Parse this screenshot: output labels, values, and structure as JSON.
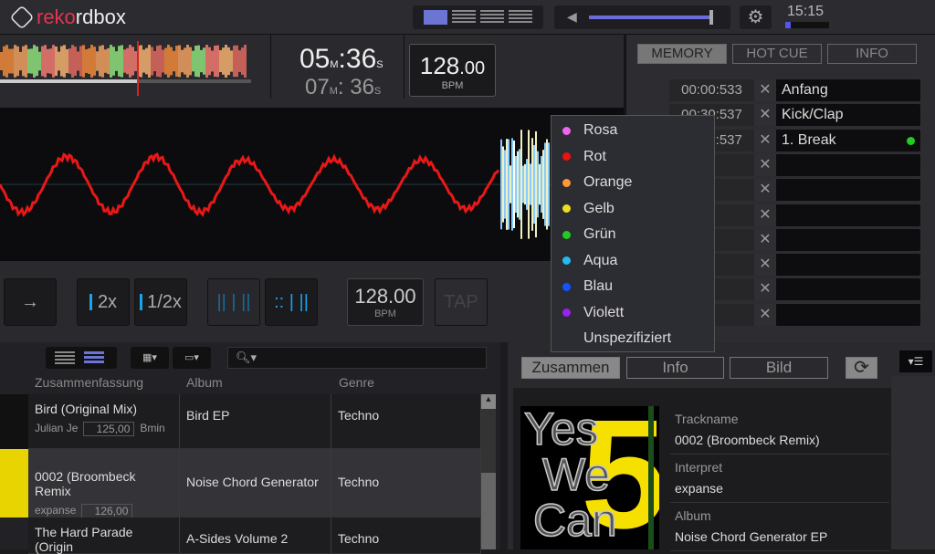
{
  "app": {
    "name_part1": "reko",
    "name_part2": "rdbox",
    "clock": "15:15"
  },
  "deck": {
    "time_elapsed_m": "05",
    "time_elapsed_s": "36",
    "time_remain_m": "07",
    "time_remain_s": "36",
    "unit_m": "M",
    "unit_s": "S",
    "bpm_int": "128",
    "bpm_dec": ".00",
    "bpm_label": "BPM",
    "buttons": {
      "arrow": "→",
      "double": "2x",
      "half": "1/2x",
      "tempo": "128.00",
      "tempo_label": "BPM",
      "tap": "TAP"
    }
  },
  "cue_panel": {
    "tabs": [
      "MEMORY",
      "HOT CUE",
      "INFO"
    ],
    "rows": [
      {
        "time": "00:00:533",
        "name": "Anfang"
      },
      {
        "time": "00:30:537",
        "name": "Kick/Clap"
      },
      {
        "time": "00:??:537",
        "name": "1. Break",
        "color": "#22cc22"
      },
      {
        "time": "",
        "name": ""
      },
      {
        "time": "",
        "name": ""
      },
      {
        "time": "",
        "name": ""
      },
      {
        "time": "",
        "name": ""
      },
      {
        "time": "",
        "name": ""
      },
      {
        "time": "",
        "name": ""
      },
      {
        "time": "",
        "name": ""
      }
    ],
    "remove": "✕"
  },
  "color_menu": [
    {
      "label": "Rosa",
      "color": "#ee66ee"
    },
    {
      "label": "Rot",
      "color": "#ee1111"
    },
    {
      "label": "Orange",
      "color": "#ff9933"
    },
    {
      "label": "Gelb",
      "color": "#eedd22"
    },
    {
      "label": "Grün",
      "color": "#22cc22"
    },
    {
      "label": "Aqua",
      "color": "#22bbee"
    },
    {
      "label": "Blau",
      "color": "#1155ff"
    },
    {
      "label": "Violett",
      "color": "#9922ee"
    },
    {
      "label": "Unspezifiziert",
      "color": ""
    }
  ],
  "browser": {
    "columns": [
      "Zusammenfassung",
      "Album",
      "Genre"
    ],
    "rows": [
      {
        "title": "Bird (Original Mix)",
        "artist": "Julian Je",
        "bpm": "125,00",
        "key": "Bmin",
        "album": "Bird EP",
        "genre": "Techno"
      },
      {
        "title": "0002 (Broombeck Remix",
        "artist": "expanse",
        "bpm": "126,00",
        "key": "",
        "album": "Noise Chord Generator",
        "genre": "Techno",
        "selected": true
      },
      {
        "title": "The Hard Parade (Origin",
        "artist": "",
        "bpm": "",
        "key": "",
        "album": "A-Sides Volume 2",
        "genre": "Techno"
      }
    ]
  },
  "info_panel": {
    "tabs": [
      "Zusammen",
      "Info",
      "Bild"
    ],
    "art_text": [
      "Yes",
      "We",
      "Can",
      "5"
    ],
    "fields": [
      {
        "label": "Trackname",
        "value": "0002 (Broombeck Remix)"
      },
      {
        "label": "Interpret",
        "value": "expanse"
      },
      {
        "label": "Album",
        "value": "Noise Chord Generator EP"
      }
    ]
  },
  "colors": {
    "accent": "#e5354e",
    "blue": "#1aa3e8",
    "volume": "#6c6cd8"
  }
}
